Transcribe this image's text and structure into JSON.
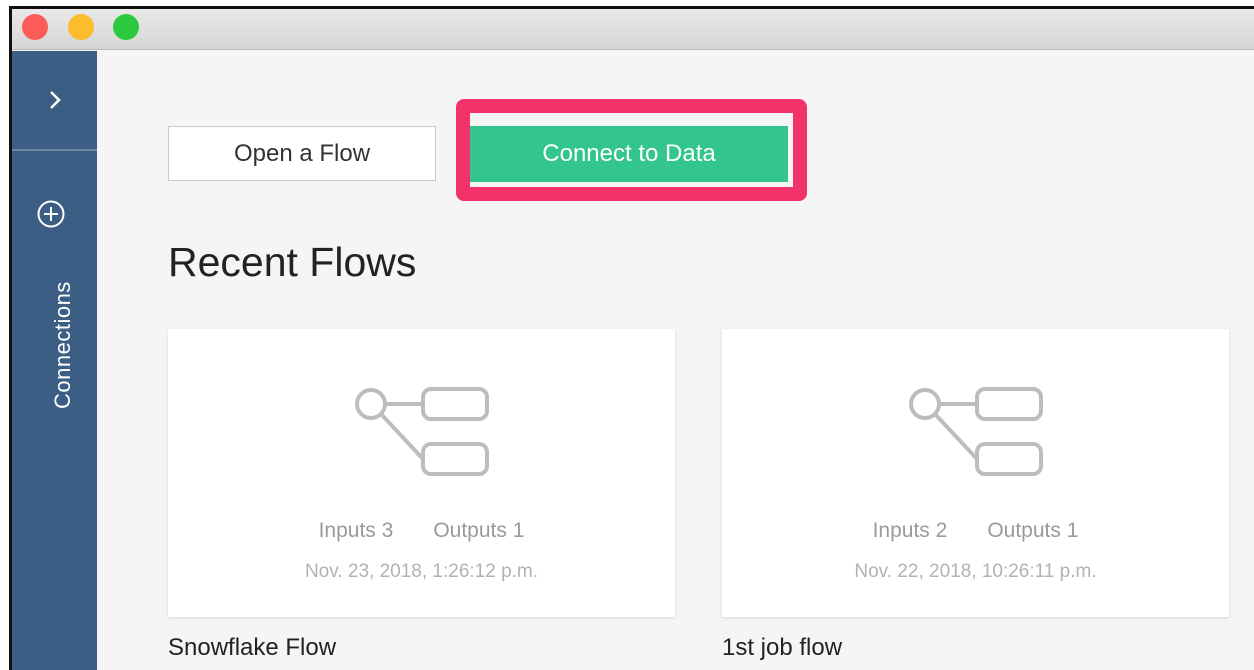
{
  "sidebar": {
    "expand_icon": "chevron-right-icon",
    "add_icon": "plus-circle-icon",
    "connections_label": "Connections"
  },
  "actions": {
    "open_flow_label": "Open a Flow",
    "connect_label": "Connect to Data"
  },
  "recent": {
    "title": "Recent Flows",
    "flows": [
      {
        "name": "Snowflake Flow",
        "inputs": "Inputs 3",
        "outputs": "Outputs 1",
        "date": "Nov. 23, 2018, 1:26:12 p.m."
      },
      {
        "name": "1st job flow",
        "inputs": "Inputs 2",
        "outputs": "Outputs 1",
        "date": "Nov. 22, 2018, 10:26:11 p.m."
      }
    ]
  },
  "colors": {
    "sidebar": "#3c5e84",
    "connect_button": "#33c58e",
    "highlight": "#f2336b"
  }
}
